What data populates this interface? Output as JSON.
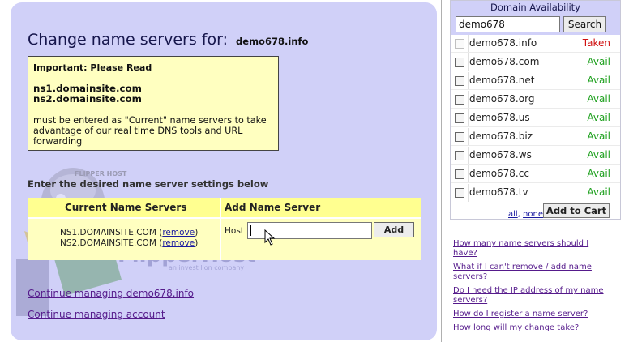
{
  "main": {
    "title": "Change name servers for:",
    "domain": "demo678.info",
    "notice": {
      "header": "Important: Please Read",
      "ns1": "ns1.domainsite.com",
      "ns2": "ns2.domainsite.com",
      "body": "must be entered as \"Current\" name servers to take advantage of our real time DNS tools and URL forwarding"
    },
    "section_label": "Enter the desired name server settings below",
    "table": {
      "col_current": "Current Name Servers",
      "col_add": "Add Name Server",
      "current": [
        {
          "name": "NS1.DOMAINSITE.COM",
          "remove": "remove"
        },
        {
          "name": "NS2.DOMAINSITE.COM",
          "remove": "remove"
        }
      ],
      "host_label": "Host :",
      "host_value": "",
      "add_label": "Add"
    },
    "links": {
      "continue_domain": "Continue managing demo678.info",
      "continue_account": "Continue managing account"
    },
    "watermark": {
      "brand": "FlipperHost",
      "tagline": "an invest lion company",
      "badge": "FLIPPER HOST"
    }
  },
  "availability": {
    "title": "Domain Availability",
    "search_value": "demo678",
    "search_label": "Search",
    "rows": [
      {
        "domain": "demo678.info",
        "status": "Taken"
      },
      {
        "domain": "demo678.com",
        "status": "Avail"
      },
      {
        "domain": "demo678.net",
        "status": "Avail"
      },
      {
        "domain": "demo678.org",
        "status": "Avail"
      },
      {
        "domain": "demo678.us",
        "status": "Avail"
      },
      {
        "domain": "demo678.biz",
        "status": "Avail"
      },
      {
        "domain": "demo678.ws",
        "status": "Avail"
      },
      {
        "domain": "demo678.cc",
        "status": "Avail"
      },
      {
        "domain": "demo678.tv",
        "status": "Avail"
      }
    ],
    "all_label": "all",
    "none_label": "none",
    "cart_label": "Add to Cart"
  },
  "faq": [
    "How many name servers should I have?",
    "What if I can't remove / add name servers?",
    "Do I need the IP address of my name servers?",
    "How do I register a name server?",
    "How long will my change take?"
  ],
  "colors": {
    "panel": "#d0d0f8",
    "notice": "#ffffc0",
    "avail": "#1ea01e",
    "taken": "#d01010"
  }
}
